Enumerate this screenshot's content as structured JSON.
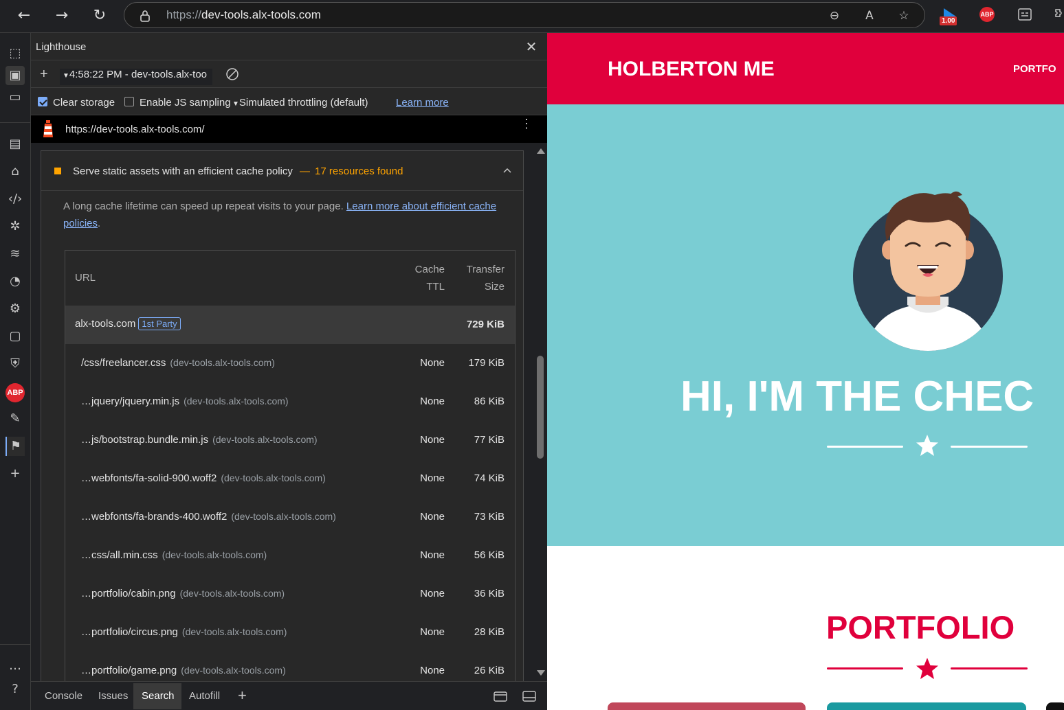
{
  "browser": {
    "url_proto": "https://",
    "url_host": "dev-tools.alx-tools.com",
    "ext_badge": "1.00",
    "abp_label": "ABP"
  },
  "devtools": {
    "panel_title": "Lighthouse",
    "report_selector": "4:58:22 PM - dev-tools.alx-too",
    "clear_storage_label": "Clear storage",
    "clear_storage_checked": true,
    "js_sampling_label": "Enable JS sampling",
    "js_sampling_checked": false,
    "throttling_label": "Simulated throttling (default)",
    "learn_more": "Learn more",
    "report_url": "https://dev-tools.alx-tools.com/",
    "audit": {
      "title": "Serve static assets with an efficient cache policy",
      "dash": "—",
      "summary": "17 resources found",
      "description": "A long cache lifetime can speed up repeat visits to your page.",
      "link_text_1": "Learn more about efficient cache",
      "link_text_2": "policies",
      "period": ".",
      "columns": {
        "url": "URL",
        "cache_1": "Cache",
        "cache_2": "TTL",
        "size_1": "Transfer",
        "size_2": "Size"
      },
      "party": {
        "name": "alx-tools.com",
        "badge": "1st Party",
        "size": "729 KiB"
      },
      "rows": [
        {
          "url": "/css/freelancer.css",
          "host": "(dev-tools.alx-tools.com)",
          "ttl": "None",
          "size": "179 KiB"
        },
        {
          "url": "…jquery/jquery.min.js",
          "host": "(dev-tools.alx-tools.com)",
          "ttl": "None",
          "size": "86 KiB"
        },
        {
          "url": "…js/bootstrap.bundle.min.js",
          "host": "(dev-tools.alx-tools.com)",
          "ttl": "None",
          "size": "77 KiB"
        },
        {
          "url": "…webfonts/fa-solid-900.woff2",
          "host": "(dev-tools.alx-tools.com)",
          "ttl": "None",
          "size": "74 KiB"
        },
        {
          "url": "…webfonts/fa-brands-400.woff2",
          "host": "(dev-tools.alx-tools.com)",
          "ttl": "None",
          "size": "73 KiB"
        },
        {
          "url": "…css/all.min.css",
          "host": "(dev-tools.alx-tools.com)",
          "ttl": "None",
          "size": "56 KiB"
        },
        {
          "url": "…portfolio/cabin.png",
          "host": "(dev-tools.alx-tools.com)",
          "ttl": "None",
          "size": "36 KiB"
        },
        {
          "url": "…portfolio/circus.png",
          "host": "(dev-tools.alx-tools.com)",
          "ttl": "None",
          "size": "28 KiB"
        },
        {
          "url": "…portfolio/game.png",
          "host": "(dev-tools.alx-tools.com)",
          "ttl": "None",
          "size": "26 KiB"
        }
      ]
    },
    "drawer_tabs": [
      {
        "label": "Console"
      },
      {
        "label": "Issues"
      },
      {
        "label": "Search"
      },
      {
        "label": "Autofill"
      }
    ]
  },
  "site": {
    "brand": "HOLBERTON ME",
    "nav_link": "PORTFO",
    "hero_title": "HI, I'M THE CHEC",
    "portfolio_title": "PORTFOLIO",
    "colors": {
      "primary": "#e0003c",
      "hero_bg": "#7acdd3"
    }
  }
}
